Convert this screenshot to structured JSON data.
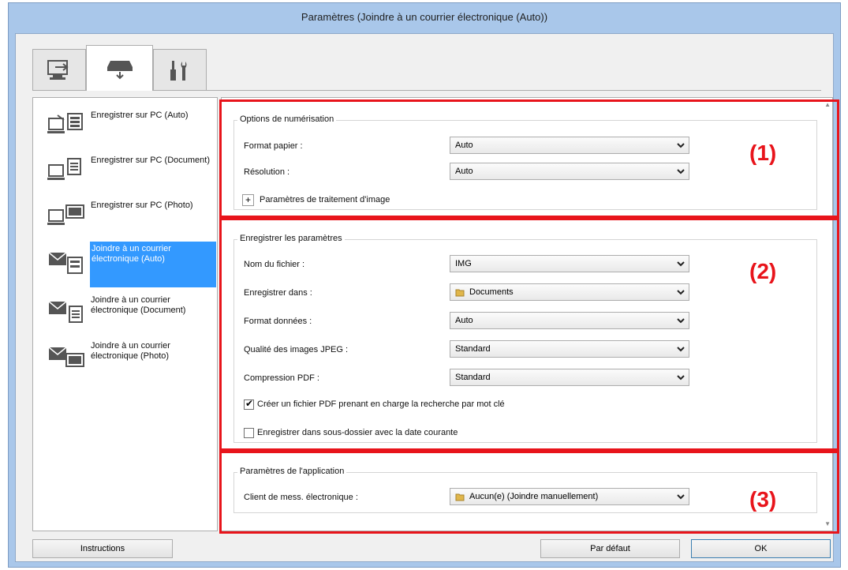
{
  "window": {
    "title": "Paramètres (Joindre à un courrier électronique (Auto))"
  },
  "tabs": [
    {
      "icon": "scan-from-computer-icon"
    },
    {
      "icon": "scan-from-operation-panel-icon"
    },
    {
      "icon": "general-settings-icon"
    }
  ],
  "left_list": {
    "items": [
      {
        "label": "Enregistrer sur PC (Auto)",
        "icon": "save-to-pc-auto-icon",
        "selected": false
      },
      {
        "label": "Enregistrer sur PC (Document)",
        "icon": "save-to-pc-document-icon",
        "selected": false
      },
      {
        "label": "Enregistrer sur PC (Photo)",
        "icon": "save-to-pc-photo-icon",
        "selected": false
      },
      {
        "label": "Joindre à un courrier électronique (Auto)",
        "icon": "attach-email-auto-icon",
        "selected": true
      },
      {
        "label": "Joindre à un courrier électronique (Document)",
        "icon": "attach-email-document-icon",
        "selected": false
      },
      {
        "label": "Joindre à un courrier électronique (Photo)",
        "icon": "attach-email-photo-icon",
        "selected": false
      }
    ]
  },
  "scan_options": {
    "title": "Options de numérisation",
    "paper_size_label": "Format papier :",
    "paper_size_value": "Auto",
    "resolution_label": "Résolution :",
    "resolution_value": "Auto",
    "image_processing_label": "Paramètres de traitement d'image",
    "callout": "(1)"
  },
  "save_settings": {
    "title": "Enregistrer les paramètres",
    "file_name_label": "Nom du fichier :",
    "file_name_value": "IMG",
    "save_in_label": "Enregistrer dans :",
    "save_in_value": "Documents",
    "data_format_label": "Format données :",
    "data_format_value": "Auto",
    "jpeg_quality_label": "Qualité des images JPEG :",
    "jpeg_quality_value": "Standard",
    "pdf_compression_label": "Compression PDF :",
    "pdf_compression_value": "Standard",
    "keyword_pdf_label": "Créer un fichier PDF prenant en charge la recherche par mot clé",
    "keyword_pdf_checked": true,
    "subfolder_label": "Enregistrer dans sous-dossier avec la date courante",
    "subfolder_checked": false,
    "callout": "(2)"
  },
  "app_settings": {
    "title": "Paramètres de l'application",
    "email_client_label": "Client de mess. électronique :",
    "email_client_value": "Aucun(e) (Joindre manuellement)",
    "callout": "(3)"
  },
  "buttons": {
    "instructions": "Instructions",
    "defaults": "Par défaut",
    "ok": "OK"
  },
  "colors": {
    "callout_red": "#e8141b",
    "selection_blue": "#3399ff",
    "window_frame": "#a9c7ea"
  }
}
